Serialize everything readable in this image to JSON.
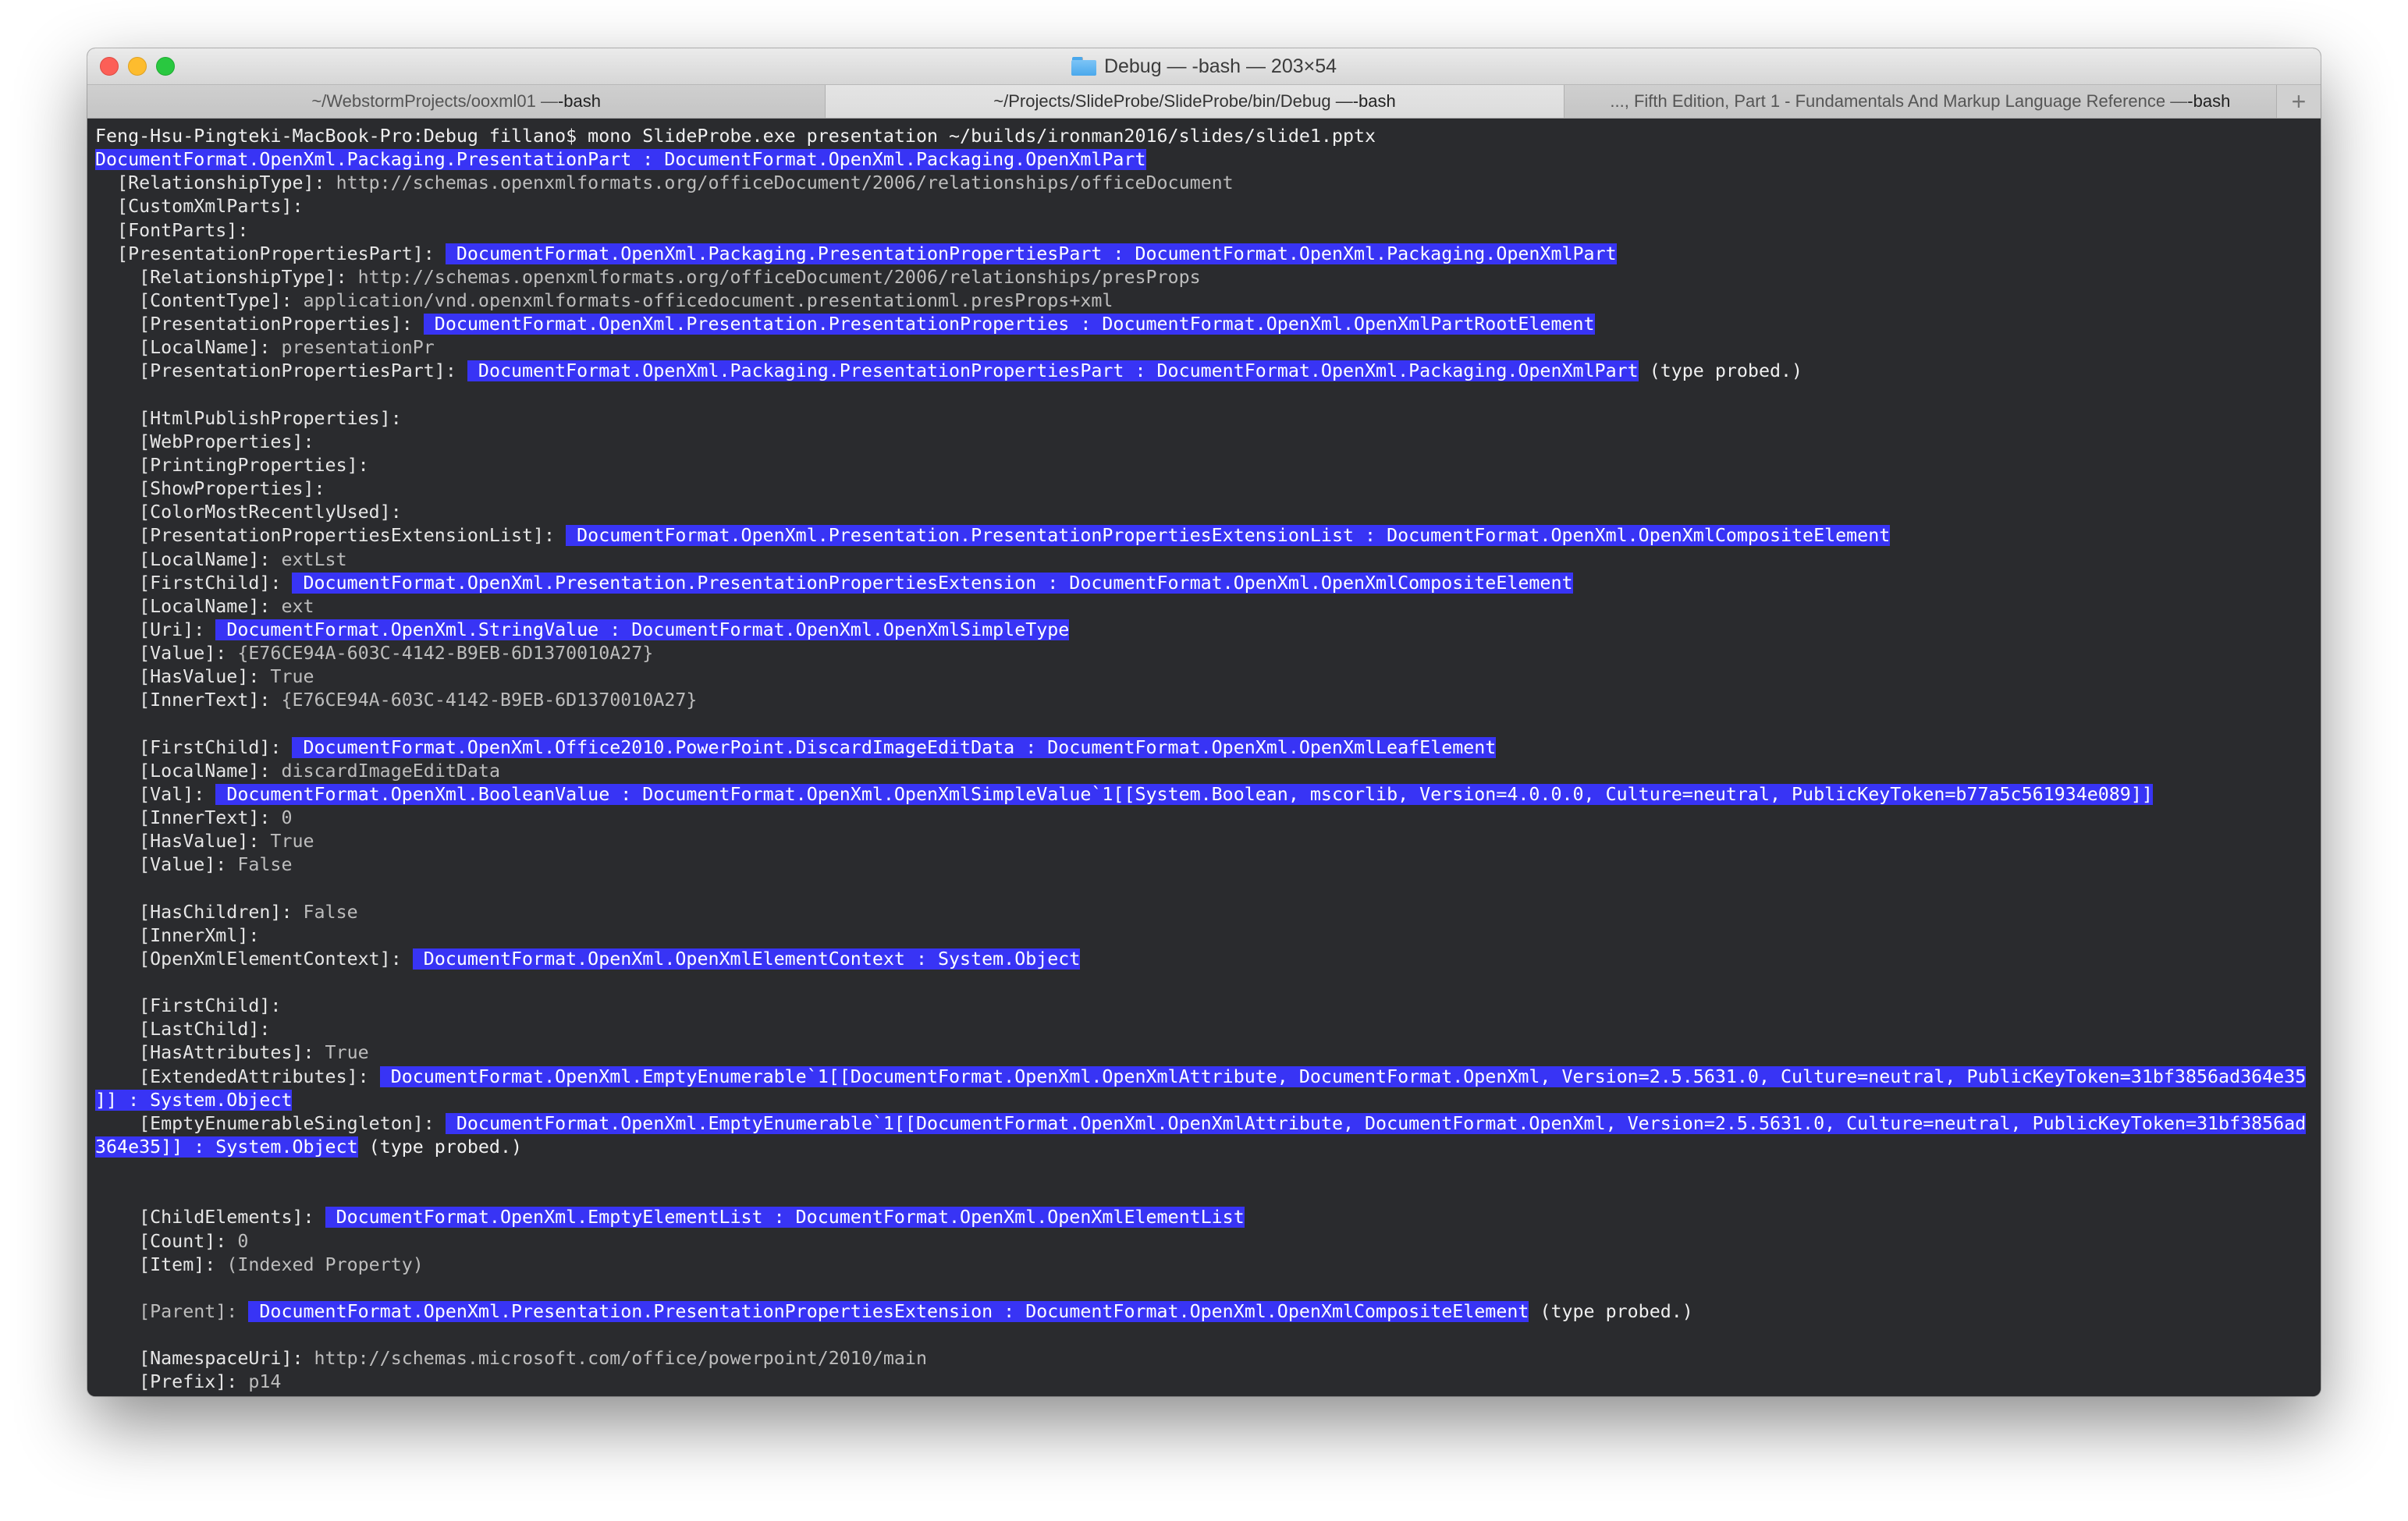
{
  "window": {
    "title": "Debug — -bash — 203×54",
    "tabs": [
      {
        "label": "~/WebstormProjects/ooxml01 — ",
        "label_bold": "-bash",
        "active": false
      },
      {
        "label": "~/Projects/SlideProbe/SlideProbe/bin/Debug — ",
        "label_bold": "-bash",
        "active": true
      },
      {
        "label": "..., Fifth Edition, Part 1 - Fundamentals And Markup Language Reference — ",
        "label_bold": "-bash",
        "active": false
      }
    ],
    "add_tab_label": "+"
  },
  "terminal": {
    "lines": [
      [
        {
          "t": "Feng-Hsu-Pingteki-MacBook-Pro:Debug fillano$ mono SlideProbe.exe presentation ~/builds/ironman2016/slides/slide1.pptx",
          "c": "bright"
        }
      ],
      [
        {
          "t": "DocumentFormat.OpenXml.Packaging.PresentationPart : DocumentFormat.OpenXml.Packaging.OpenXmlPart",
          "c": "hl-sel"
        }
      ],
      [
        {
          "t": "  [RelationshipType]: ",
          "c": "key"
        },
        {
          "t": "http://schemas.openxmlformats.org/officeDocument/2006/relationships/officeDocument",
          "c": "dim"
        }
      ],
      [
        {
          "t": "  [CustomXmlParts]:",
          "c": "key"
        }
      ],
      [
        {
          "t": "  [FontParts]:",
          "c": "key"
        }
      ],
      [
        {
          "t": "  [PresentationPropertiesPart]: ",
          "c": "key"
        },
        {
          "t": " DocumentFormat.OpenXml.Packaging.PresentationPropertiesPart : DocumentFormat.OpenXml.Packaging.OpenXmlPart",
          "c": "hl-sel"
        }
      ],
      [
        {
          "t": "    [RelationshipType]: ",
          "c": "key"
        },
        {
          "t": "http://schemas.openxmlformats.org/officeDocument/2006/relationships/presProps",
          "c": "dim"
        }
      ],
      [
        {
          "t": "    [ContentType]: ",
          "c": "key"
        },
        {
          "t": "application/vnd.openxmlformats-officedocument.presentationml.presProps+xml",
          "c": "dim"
        }
      ],
      [
        {
          "t": "    [PresentationProperties]: ",
          "c": "key"
        },
        {
          "t": " DocumentFormat.OpenXml.Presentation.PresentationProperties : DocumentFormat.OpenXml.OpenXmlPartRootElement",
          "c": "hl-sel"
        }
      ],
      [
        {
          "t": "    [LocalName]: ",
          "c": "key"
        },
        {
          "t": "presentationPr",
          "c": "dim"
        }
      ],
      [
        {
          "t": "    [PresentationPropertiesPart]: ",
          "c": "key"
        },
        {
          "t": " DocumentFormat.OpenXml.Packaging.PresentationPropertiesPart : DocumentFormat.OpenXml.Packaging.OpenXmlPart",
          "c": "hl-sel"
        },
        {
          "t": " (type probed.)",
          "c": "bright"
        }
      ],
      [
        {
          "t": "",
          "c": "dim"
        }
      ],
      [
        {
          "t": "    [HtmlPublishProperties]:",
          "c": "key"
        }
      ],
      [
        {
          "t": "    [WebProperties]:",
          "c": "key"
        }
      ],
      [
        {
          "t": "    [PrintingProperties]:",
          "c": "key"
        }
      ],
      [
        {
          "t": "    [ShowProperties]:",
          "c": "key"
        }
      ],
      [
        {
          "t": "    [ColorMostRecentlyUsed]:",
          "c": "key"
        }
      ],
      [
        {
          "t": "    [PresentationPropertiesExtensionList]: ",
          "c": "key"
        },
        {
          "t": " DocumentFormat.OpenXml.Presentation.PresentationPropertiesExtensionList : DocumentFormat.OpenXml.OpenXmlCompositeElement",
          "c": "hl-sel"
        }
      ],
      [
        {
          "t": "    [LocalName]: ",
          "c": "key"
        },
        {
          "t": "extLst",
          "c": "dim"
        }
      ],
      [
        {
          "t": "    [FirstChild]: ",
          "c": "key"
        },
        {
          "t": " DocumentFormat.OpenXml.Presentation.PresentationPropertiesExtension : DocumentFormat.OpenXml.OpenXmlCompositeElement",
          "c": "hl-sel"
        }
      ],
      [
        {
          "t": "    [LocalName]: ",
          "c": "key"
        },
        {
          "t": "ext",
          "c": "dim"
        }
      ],
      [
        {
          "t": "    [Uri]: ",
          "c": "key"
        },
        {
          "t": " DocumentFormat.OpenXml.StringValue : DocumentFormat.OpenXml.OpenXmlSimpleType",
          "c": "hl-sel"
        }
      ],
      [
        {
          "t": "    [Value]: ",
          "c": "key"
        },
        {
          "t": "{E76CE94A-603C-4142-B9EB-6D1370010A27}",
          "c": "dim"
        }
      ],
      [
        {
          "t": "    [HasValue]: ",
          "c": "key"
        },
        {
          "t": "True",
          "c": "dim"
        }
      ],
      [
        {
          "t": "    [InnerText]: ",
          "c": "key"
        },
        {
          "t": "{E76CE94A-603C-4142-B9EB-6D1370010A27}",
          "c": "dim"
        }
      ],
      [
        {
          "t": "",
          "c": "dim"
        }
      ],
      [
        {
          "t": "    [FirstChild]: ",
          "c": "key"
        },
        {
          "t": " DocumentFormat.OpenXml.Office2010.PowerPoint.DiscardImageEditData : DocumentFormat.OpenXml.OpenXmlLeafElement",
          "c": "hl-sel"
        }
      ],
      [
        {
          "t": "    [LocalName]: ",
          "c": "key"
        },
        {
          "t": "discardImageEditData",
          "c": "dim"
        }
      ],
      [
        {
          "t": "    [Val]: ",
          "c": "key"
        },
        {
          "t": " DocumentFormat.OpenXml.BooleanValue : DocumentFormat.OpenXml.OpenXmlSimpleValue`1[[System.Boolean, mscorlib, Version=4.0.0.0, Culture=neutral, PublicKeyToken=b77a5c561934e089]]",
          "c": "hl-sel"
        }
      ],
      [
        {
          "t": "    [InnerText]: ",
          "c": "key"
        },
        {
          "t": "0",
          "c": "dim"
        }
      ],
      [
        {
          "t": "    [HasValue]: ",
          "c": "key"
        },
        {
          "t": "True",
          "c": "dim"
        }
      ],
      [
        {
          "t": "    [Value]: ",
          "c": "key"
        },
        {
          "t": "False",
          "c": "dim"
        }
      ],
      [
        {
          "t": "",
          "c": "dim"
        }
      ],
      [
        {
          "t": "    [HasChildren]: ",
          "c": "key"
        },
        {
          "t": "False",
          "c": "dim"
        }
      ],
      [
        {
          "t": "    [InnerXml]:",
          "c": "key"
        }
      ],
      [
        {
          "t": "    [OpenXmlElementContext]: ",
          "c": "key"
        },
        {
          "t": " DocumentFormat.OpenXml.OpenXmlElementContext : System.Object",
          "c": "hl-sel"
        }
      ],
      [
        {
          "t": "",
          "c": "dim"
        }
      ],
      [
        {
          "t": "    [FirstChild]:",
          "c": "key"
        }
      ],
      [
        {
          "t": "    [LastChild]:",
          "c": "key"
        }
      ],
      [
        {
          "t": "    [HasAttributes]: ",
          "c": "key"
        },
        {
          "t": "True",
          "c": "dim"
        }
      ],
      [
        {
          "t": "    [ExtendedAttributes]: ",
          "c": "key"
        },
        {
          "t": " DocumentFormat.OpenXml.EmptyEnumerable`1[[DocumentFormat.OpenXml.OpenXmlAttribute, DocumentFormat.OpenXml, Version=2.5.5631.0, Culture=neutral, PublicKeyToken=31bf3856ad364e35",
          "c": "hl-sel"
        }
      ],
      [
        {
          "t": "]] : System.Object",
          "c": "hl-sel"
        }
      ],
      [
        {
          "t": "    [EmptyEnumerableSingleton]: ",
          "c": "key"
        },
        {
          "t": " DocumentFormat.OpenXml.EmptyEnumerable`1[[DocumentFormat.OpenXml.OpenXmlAttribute, DocumentFormat.OpenXml, Version=2.5.5631.0, Culture=neutral, PublicKeyToken=31bf3856ad",
          "c": "hl-sel"
        }
      ],
      [
        {
          "t": "364e35]] : System.Object",
          "c": "hl-sel"
        },
        {
          "t": " (type probed.)",
          "c": "bright"
        }
      ],
      [
        {
          "t": "",
          "c": "dim"
        }
      ],
      [
        {
          "t": "",
          "c": "dim"
        }
      ],
      [
        {
          "t": "    [ChildElements]: ",
          "c": "key"
        },
        {
          "t": " DocumentFormat.OpenXml.EmptyElementList : DocumentFormat.OpenXml.OpenXmlElementList",
          "c": "hl-sel"
        }
      ],
      [
        {
          "t": "    [Count]: ",
          "c": "key"
        },
        {
          "t": "0",
          "c": "dim"
        }
      ],
      [
        {
          "t": "    [Item]: ",
          "c": "key"
        },
        {
          "t": "(Indexed Property)",
          "c": "dim"
        }
      ],
      [
        {
          "t": "",
          "c": "dim"
        }
      ],
      [
        {
          "t": "    [Parent]: ",
          "c": "dim"
        },
        {
          "t": " DocumentFormat.OpenXml.Presentation.PresentationPropertiesExtension : DocumentFormat.OpenXml.OpenXmlCompositeElement",
          "c": "hl-sel"
        },
        {
          "t": " (type probed.)",
          "c": "bright"
        }
      ],
      [
        {
          "t": "",
          "c": "dim"
        }
      ],
      [
        {
          "t": "    [NamespaceUri]: ",
          "c": "key"
        },
        {
          "t": "http://schemas.microsoft.com/office/powerpoint/2010/main",
          "c": "dim"
        }
      ],
      [
        {
          "t": "    [Prefix]: ",
          "c": "key"
        },
        {
          "t": "p14",
          "c": "dim"
        }
      ]
    ]
  }
}
